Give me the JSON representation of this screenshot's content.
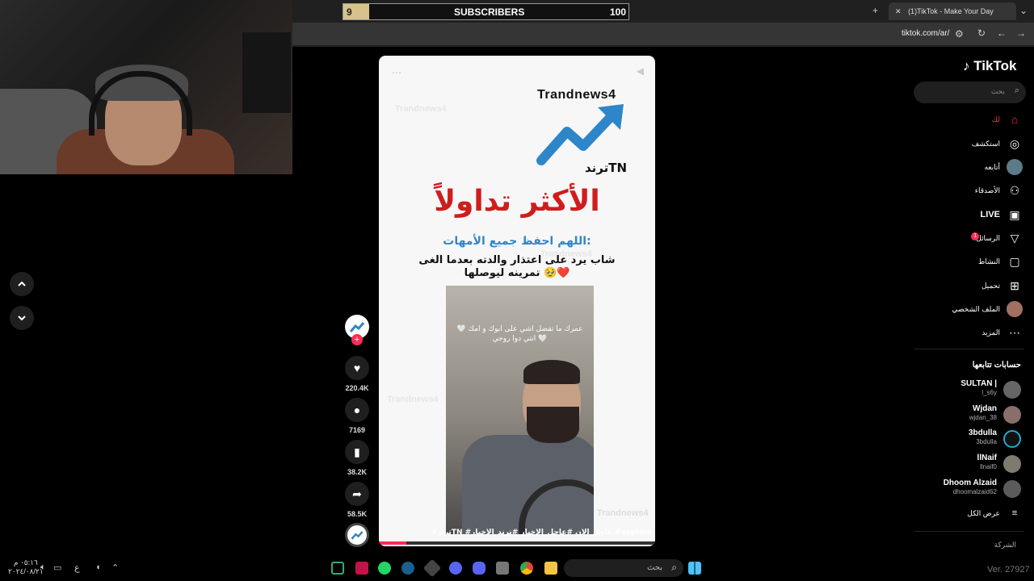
{
  "stream_overlay": {
    "subscribers_label": "SUBSCRIBERS",
    "subscribers_current": "9",
    "subscribers_goal": "100",
    "progress_fraction": 0.09,
    "version": "Ver. 27927"
  },
  "browser": {
    "tab_title": "(1)TikTok - Make Your Day",
    "url": "tiktok.com/ar/"
  },
  "sidebar": {
    "logo": "TikTok",
    "search_placeholder": "بحث",
    "nav": [
      {
        "label": "لك",
        "icon": "home-icon"
      },
      {
        "label": "استكشف",
        "icon": "compass-icon"
      },
      {
        "label": "أتابعه",
        "icon": "avatar-icon"
      },
      {
        "label": "الأصدقاء",
        "icon": "friends-icon"
      },
      {
        "label": "LIVE",
        "icon": "live-icon"
      },
      {
        "label": "الرسائل",
        "icon": "messages-icon",
        "badge": "1"
      },
      {
        "label": "النشاط",
        "icon": "activity-icon"
      },
      {
        "label": "تحميل",
        "icon": "upload-icon"
      },
      {
        "label": "الملف الشخصي",
        "icon": "profile-icon"
      },
      {
        "label": "المزيد",
        "icon": "more-icon"
      }
    ],
    "following_title": "حسابات تتابعها",
    "following": [
      {
        "name": "SULTAN |",
        "handle": "l_s6y"
      },
      {
        "name": "Wjdan",
        "handle": "wjdan_38"
      },
      {
        "name": "3bdulla",
        "handle": "3bdulla"
      },
      {
        "name": "llNaif",
        "handle": "llnaif0"
      },
      {
        "name": "Dhoom Alzaid",
        "handle": "dhoomalzaid62"
      }
    ],
    "see_all": "عرض الكل",
    "company": "الشركة"
  },
  "video": {
    "brand": "Trandnews4",
    "brand_tag": "ترندTN",
    "headline": "الأكثر تداولاً",
    "subtitle": "اللهم احفظ جميع الأمهات:",
    "caption": "شاب يرد على اعتذار والدته بعدما الغى تمرينه ليوصلها 🥹❤️",
    "overlay_text": "عمرك ما تفضل اشي على ابوك و امك 🤍 انتي دوا روحي 🤍",
    "watermark": "Trandnews4",
    "hashtags": "#ترندTN #عاجل_الان #عاجل_الاخبار #ترند_الاخبار #explore",
    "progress_fraction": 0.1
  },
  "actions": {
    "likes": "220.4K",
    "comments": "7169",
    "saves": "38.2K",
    "shares": "58.5K"
  },
  "taskbar": {
    "search_placeholder": "بحث",
    "time": "٠٥:١٦ م",
    "date": "٢٠٢٤/٠٨/٢١",
    "lang": "ع"
  },
  "colors": {
    "accent": "#fe2c55",
    "headline_red": "#cf1d1d",
    "subtitle_blue": "#2e86c9",
    "sub_bar_fill": "#d8c18a"
  }
}
